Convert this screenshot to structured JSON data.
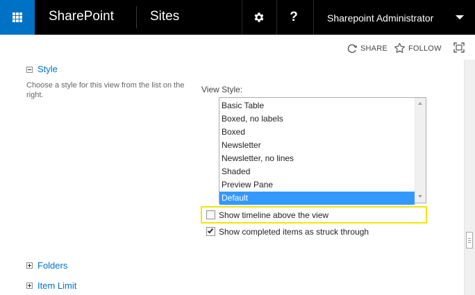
{
  "suite_bar": {
    "app_launcher_icon": "waffle-grid-icon",
    "brand": "SharePoint",
    "section": "Sites",
    "settings_icon": "gear-icon",
    "help_label": "?",
    "user_name": "Sharepoint Administrator",
    "user_menu_icon": "caret-down-icon",
    "colors": {
      "bar": "#000000",
      "launcher": "#0072c6"
    }
  },
  "action_bar": {
    "share_label": "SHARE",
    "follow_label": "FOLLOW",
    "focus_icon": "focus-on-content-icon"
  },
  "style_section": {
    "title": "Style",
    "expanded": true,
    "description": "Choose a style for this view from the list on the right.",
    "view_style_label": "View Style:",
    "options": [
      "Basic Table",
      "Boxed, no labels",
      "Boxed",
      "Newsletter",
      "Newsletter, no lines",
      "Shaded",
      "Preview Pane",
      "Default"
    ],
    "selected": "Default",
    "selected_color": "#3399ff"
  },
  "checkboxes": {
    "timeline": {
      "label": "Show timeline above the view",
      "checked": false,
      "highlight_color": "#f2e600"
    },
    "struck": {
      "label": "Show completed items as struck through",
      "checked": true
    }
  },
  "sections": {
    "folders": {
      "title": "Folders",
      "expanded": false
    },
    "item_limit": {
      "title": "Item Limit",
      "expanded": false
    }
  },
  "accent_color": "#0072c6"
}
